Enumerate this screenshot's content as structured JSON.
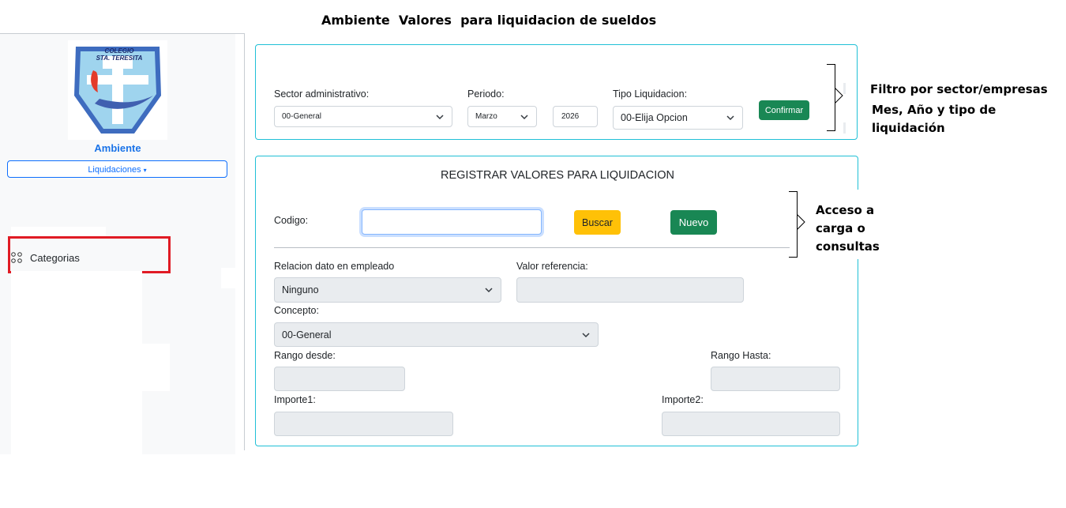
{
  "page_title": "Ambiente  Valores  para liquidacion de sueldos",
  "sidebar": {
    "logo_line1": "COLEGIO",
    "logo_line2": "STA. TERESITA",
    "env_label": "Ambiente",
    "dropdown_label": "Liquidaciones",
    "items": [
      {
        "label": "Categorias",
        "icon": "apps-grid-icon"
      }
    ]
  },
  "filter": {
    "sector_label": "Sector administrativo:",
    "sector_value": "00-General",
    "periodo_label": "Periodo:",
    "month_value": "Marzo",
    "year_value": "2026",
    "tipo_label": "Tipo Liquidacion:",
    "tipo_value": "00-Elija Opcion",
    "confirm_label": "Confirmar"
  },
  "register": {
    "title": "REGISTRAR VALORES PARA LIQUIDACION",
    "codigo_label": "Codigo:",
    "codigo_value": "",
    "buscar_label": "Buscar",
    "nuevo_label": "Nuevo",
    "relacion_label": "Relacion dato en empleado",
    "relacion_value": "Ninguno",
    "valor_ref_label": "Valor referencia:",
    "concepto_label": "Concepto:",
    "concepto_value": "00-General",
    "rango_desde_label": "Rango desde:",
    "rango_hasta_label": "Rango Hasta:",
    "importe1_label": "Importe1:",
    "importe2_label": "Importe2:"
  },
  "annotations": {
    "filter_line1": "Filtro por sector/empresas",
    "filter_line2": "Mes, Año y tipo de",
    "filter_line3": "liquidación",
    "access_line1": "Acceso a",
    "access_line2": "carga o",
    "access_line3": "consultas"
  },
  "colors": {
    "panel_border": "#20c0d6",
    "primary": "#0d6efd",
    "success": "#198754",
    "warning": "#ffc107",
    "highlight": "#e01b24"
  }
}
